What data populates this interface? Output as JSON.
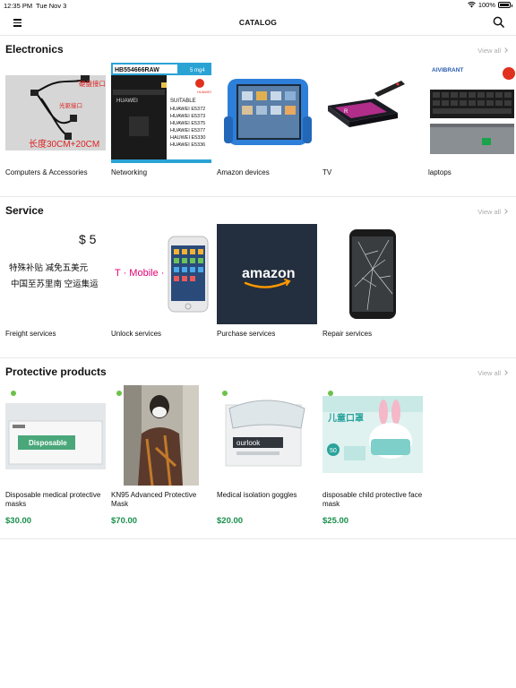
{
  "status": {
    "time": "12:35 PM",
    "date": "Tue Nov 3",
    "battery": "100%",
    "battery_level": 1.0
  },
  "nav": {
    "title": "CATALOG"
  },
  "sections": [
    {
      "title": "Electronics",
      "view_all": "View all",
      "items": [
        {
          "label": "Computers & Accessories",
          "img_text": [
            "硬盘接口",
            "光驱接口",
            "长度30CM+20CM"
          ]
        },
        {
          "label": "Networking",
          "img_text": [
            "HB554666RAW",
            "5 mg4",
            "HUAWEI",
            "SUITABLE",
            "HUAWEI E5372",
            "HUAWEI E5373",
            "HUAWEI E5375",
            "HUAWEI E5377",
            "HAUWEI E5330",
            "HUAWEI E5336"
          ]
        },
        {
          "label": "Amazon devices"
        },
        {
          "label": "TV"
        },
        {
          "label": "laptops",
          "img_text": [
            "AIVIBRANT"
          ]
        }
      ]
    },
    {
      "title": "Service",
      "view_all": "View all",
      "items": [
        {
          "label": "Freight services",
          "img_text": [
            "$ 5",
            "特殊补贴 减免五美元",
            "中国至苏里南 空运集运"
          ]
        },
        {
          "label": "Unlock services",
          "img_text": [
            "T · Mobile ·"
          ]
        },
        {
          "label": "Purchase services",
          "img_text": [
            "amazon"
          ]
        },
        {
          "label": "Repair services"
        }
      ]
    },
    {
      "title": "Protective products",
      "view_all": "View all",
      "items": [
        {
          "label": "Disposable medical protective masks",
          "price": "$30.00",
          "img_text": [
            "Disposable"
          ]
        },
        {
          "label": "KN95 Advanced Protective Mask",
          "price": "$70.00"
        },
        {
          "label": "Medical isolation goggles",
          "price": "$20.00",
          "img_text": [
            "ourlook"
          ]
        },
        {
          "label": "disposable child protective face mask",
          "price": "$25.00",
          "img_text": [
            "儿童口罩"
          ]
        }
      ]
    }
  ],
  "colors": {
    "price": "#1a8f4c",
    "badge": "#6cc24a",
    "muted": "#aaaaaa"
  }
}
